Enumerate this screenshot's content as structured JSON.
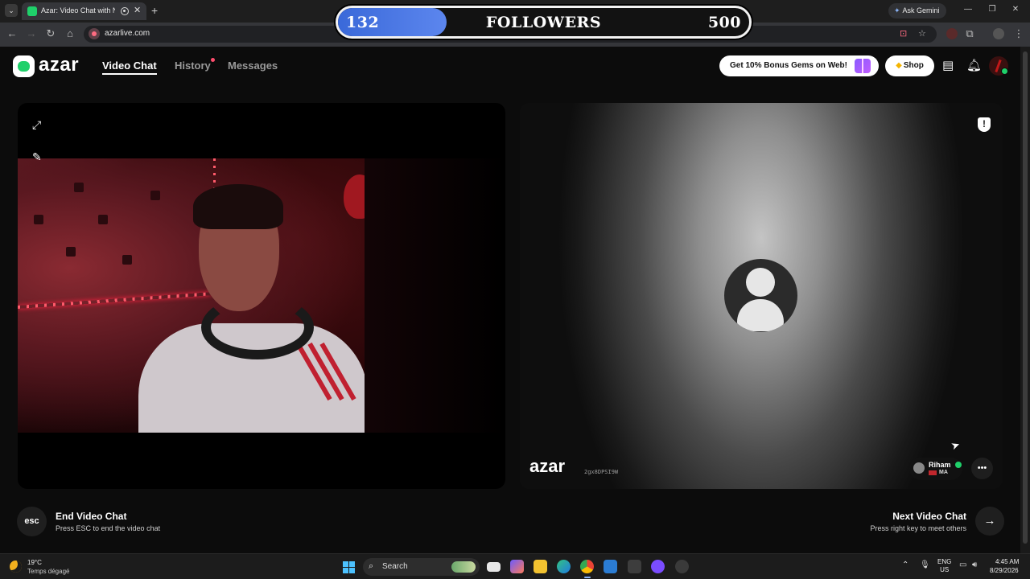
{
  "browser": {
    "tab_title": "Azar: Video Chat with New",
    "url": "azarlive.com",
    "ask_gemini": "Ask Gemini"
  },
  "followers_overlay": {
    "current": "132",
    "label": "FOLLOWERS",
    "goal": "500",
    "progress_fraction": 0.264
  },
  "header": {
    "logo_text": "azar",
    "nav": [
      {
        "label": "Video Chat",
        "active": true
      },
      {
        "label": "History",
        "has_notification": true
      },
      {
        "label": "Messages"
      }
    ],
    "promo": "Get 10% Bonus Gems on Web!",
    "shop": "Shop"
  },
  "remote": {
    "watermark": "azar",
    "session_id": "2gx8DPSI9W",
    "user": {
      "name": "Riham",
      "country": "MA",
      "verified": true
    }
  },
  "controls": {
    "end": {
      "key": "esc",
      "title": "End Video Chat",
      "subtitle": "Press ESC to end the video chat"
    },
    "next": {
      "title": "Next Video Chat",
      "subtitle": "Press right key to meet others"
    }
  },
  "taskbar": {
    "weather_temp": "19°C",
    "weather_desc": "Temps dégagé",
    "search": "Search",
    "lang": "ENG",
    "region": "US",
    "time": "4:45 AM",
    "date": "8/29/2026"
  },
  "colors": {
    "brand_green": "#1fd06a",
    "progress_blue": "#3a69d9",
    "background": "#0c0c0c"
  },
  "icons": [
    "tab-menu-icon",
    "record-icon",
    "close-icon",
    "new-tab-icon",
    "gemini-star-icon",
    "minimize-icon",
    "maximize-icon",
    "window-close-icon",
    "back-icon",
    "forward-icon",
    "reload-icon",
    "home-icon",
    "site-info-icon",
    "install-icon",
    "bookmark-star-icon",
    "extension-icon",
    "puzzle-icon",
    "profile-icon",
    "kebab-menu-icon",
    "gift-icon",
    "gem-icon",
    "inbox-icon",
    "bell-icon",
    "expand-icon",
    "magic-wand-icon",
    "report-shield-icon",
    "chat-bubble-icon",
    "arrow-right-icon",
    "windows-start-icon"
  ]
}
